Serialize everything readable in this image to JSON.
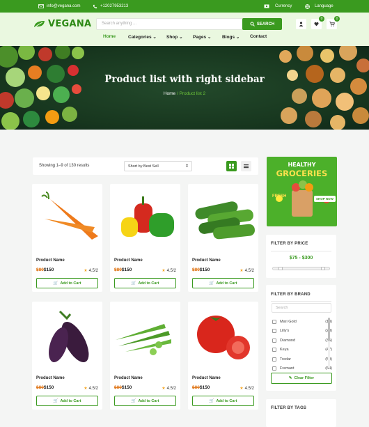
{
  "topbar": {
    "email": "info@vegana.com",
    "phone": "+12027953213",
    "currency": "Currency",
    "language": "Language"
  },
  "header": {
    "logo_text": "VEGANA",
    "search_placeholder": "Search anything ...",
    "search_label": "SEARCH",
    "wishlist_count": "0",
    "cart_count": "0"
  },
  "nav": [
    {
      "label": "Home",
      "dropdown": false
    },
    {
      "label": "Categories",
      "dropdown": true
    },
    {
      "label": "Shop",
      "dropdown": true
    },
    {
      "label": "Pages",
      "dropdown": true
    },
    {
      "label": "Blogs",
      "dropdown": true
    },
    {
      "label": "Contact",
      "dropdown": false
    }
  ],
  "hero": {
    "title": "Product list with right sidebar",
    "crumb_home": "Home",
    "crumb_sep": "/",
    "crumb_current": "Product list 2"
  },
  "toolbar": {
    "results": "Showing 1–9 of 130 results",
    "sort": "Short by Best Sell"
  },
  "products": [
    {
      "name": "Product Name",
      "old_price": "$80",
      "price": "$150",
      "rating": "4.5/2",
      "cart_label": "Add to Cart",
      "image": "carrot"
    },
    {
      "name": "Product Name",
      "old_price": "$80",
      "price": "$150",
      "rating": "4.5/2",
      "cart_label": "Add to Cart",
      "image": "bell-peppers"
    },
    {
      "name": "Product Name",
      "old_price": "$80",
      "price": "$150",
      "rating": "4.5/2",
      "cart_label": "Add to Cart",
      "image": "cucumbers"
    },
    {
      "name": "Product Name",
      "old_price": "$80",
      "price": "$150",
      "rating": "4.5/2",
      "cart_label": "Add to Cart",
      "image": "eggplant"
    },
    {
      "name": "Product Name",
      "old_price": "$80",
      "price": "$150",
      "rating": "4.5/2",
      "cart_label": "Add to Cart",
      "image": "okra"
    },
    {
      "name": "Product Name",
      "old_price": "$80",
      "price": "$150",
      "rating": "4.5/2",
      "cart_label": "Add to Cart",
      "image": "tomato"
    }
  ],
  "ad": {
    "line1": "HEALTHY",
    "line2": "GROCERIES",
    "tag": "FRESH",
    "button": "SHOP NOW"
  },
  "filter_price": {
    "title": "FILTER BY PRICE",
    "range": "$75 - $300",
    "low": 0.15,
    "high": 0.88
  },
  "filter_brand": {
    "title": "FILTER BY BRAND",
    "search_placeholder": "Search",
    "brands": [
      {
        "name": "Mari Gold",
        "count": "(13)"
      },
      {
        "name": "Lilly's",
        "count": "(28)"
      },
      {
        "name": "Diamond",
        "count": "(35)"
      },
      {
        "name": "Keya",
        "count": "(47)"
      },
      {
        "name": "Tredar",
        "count": "(59)"
      },
      {
        "name": "Fremant",
        "count": "(64)"
      }
    ],
    "clear_label": "Clear Filter"
  },
  "filter_tags": {
    "title": "FILTER BY TAGS"
  }
}
